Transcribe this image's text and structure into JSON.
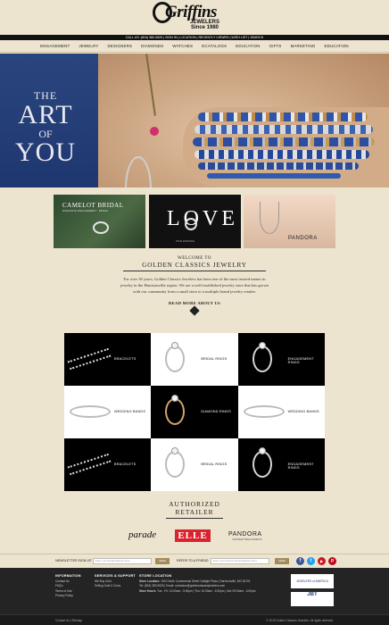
{
  "header": {
    "logo_name": "Griffins",
    "logo_sub_1": "JEWELERS",
    "logo_sub_2": "Since 1980",
    "call_bar": "CALL US: (816) 380-5525  |  SIGN IN  |  LOCATION  |  RECENTLY VIEWED  |  WISH LIST  |  SEARCH"
  },
  "nav": {
    "items": [
      "Engagement",
      "Jewelry",
      "Designers",
      "Diamonds",
      "Watches",
      "Ecatalogs",
      "Education",
      "Gifts",
      "Marketing",
      "Education"
    ]
  },
  "hero": {
    "line1": "THE",
    "line2": "ART",
    "line3": "OF",
    "line4": "YOU"
  },
  "promos": {
    "tile1_title": "CAMELOT BRIDAL",
    "tile1_sub": "EXQUISITE ENGAGEMENT · BRIDAL",
    "tile2_title": "LOVE",
    "tile2_sub": "TRUE ROMANCE",
    "tile3_brand": "PANDORA"
  },
  "welcome": {
    "to": "WELCOME TO",
    "title": "GOLDEN CLASSICS JEWELRY",
    "body": "For over 30 years, Golden Classics Jewelers has been one of the most trusted names in jewelry in the Harrisonville region. We are a well-established jewelry store that has grown with our community from a small store to a multiple brand jewelry retailer.",
    "read_more": "READ MORE ABOUT US"
  },
  "categories": [
    {
      "label": "Bracelets"
    },
    {
      "label": "Bridal Rings"
    },
    {
      "label": "Engagement Rings"
    },
    {
      "label": "Wedding Bands"
    },
    {
      "label": "Diamond Rings"
    },
    {
      "label": "Wedding Bands"
    },
    {
      "label": "Bracelets"
    },
    {
      "label": "Bridal Rings"
    },
    {
      "label": "Engagement Rings"
    }
  ],
  "authorized": {
    "line1": "AUTHORIZED",
    "line2": "RETAILER",
    "brands": {
      "parade": "parade",
      "elle": "ELLE",
      "pandora": "PANDORA",
      "pandora_sub": "UNFORGETTABLE MOMENTS"
    }
  },
  "newsletter": {
    "label": "NEWSLETTER SIGN UP",
    "placeholder": "Enter your Email Address Here",
    "button": "SEND",
    "refer_label": "REFER TO A FRIEND",
    "refer_placeholder": "Enter your Friend's Email Address Here",
    "refer_button": "SEND"
  },
  "social": [
    {
      "icon": "facebook-icon",
      "glyph": "f",
      "color": "#3b5998"
    },
    {
      "icon": "twitter-icon",
      "glyph": "t",
      "color": "#1da1f2"
    },
    {
      "icon": "youtube-icon",
      "glyph": "▶",
      "color": "#cc181e"
    },
    {
      "icon": "pinterest-icon",
      "glyph": "p",
      "color": "#bd081c"
    }
  ],
  "footer": {
    "info_head": "INFORMATION",
    "info_items": [
      "Contact Us",
      "FAQ's",
      "Terms of Use",
      "Privacy Policy"
    ],
    "services_head": "SERVICES & SUPPORT",
    "services_items": [
      "We Buy Gold",
      "Selling Gold & Coins"
    ],
    "store_head": "STORE LOCATION",
    "store_location_label": "Store Location:",
    "store_location": "1910 North Commercial Street  Catlight Plaza | Harrisonville, MO 64701",
    "store_tel": "Tel: (816) 380-5525 | Email: contactus@goldenclassicsjewelers.com",
    "store_hours_label": "Store Hours:",
    "store_hours": "Tue - Fri: 10:00am - 5:30pm | Thu: 10:00am - 6:30pm | Sat: 09:00am - 4:00pm",
    "badge1": "JEWELERS of AMERICA",
    "badge2": "JBT",
    "bottom_left": "Contact Us  |  Sitemap",
    "copyright": "© 2015 Golden Classics Jewelers. All rights reserved."
  }
}
